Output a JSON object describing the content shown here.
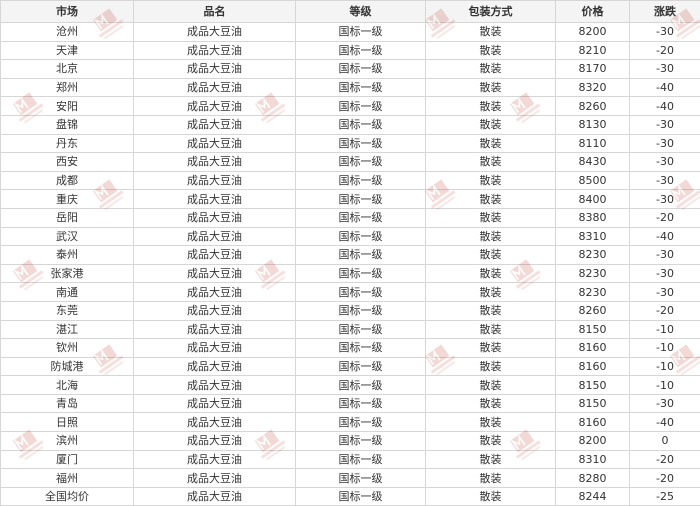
{
  "table": {
    "headers": [
      "市场",
      "品名",
      "等级",
      "包装方式",
      "价格",
      "涨跌"
    ],
    "rows": [
      [
        "沧州",
        "成品大豆油",
        "国标一级",
        "散装",
        "8200",
        "-30"
      ],
      [
        "天津",
        "成品大豆油",
        "国标一级",
        "散装",
        "8210",
        "-20"
      ],
      [
        "北京",
        "成品大豆油",
        "国标一级",
        "散装",
        "8170",
        "-30"
      ],
      [
        "郑州",
        "成品大豆油",
        "国标一级",
        "散装",
        "8320",
        "-40"
      ],
      [
        "安阳",
        "成品大豆油",
        "国标一级",
        "散装",
        "8260",
        "-40"
      ],
      [
        "盘锦",
        "成品大豆油",
        "国标一级",
        "散装",
        "8130",
        "-30"
      ],
      [
        "丹东",
        "成品大豆油",
        "国标一级",
        "散装",
        "8110",
        "-30"
      ],
      [
        "西安",
        "成品大豆油",
        "国标一级",
        "散装",
        "8430",
        "-30"
      ],
      [
        "成都",
        "成品大豆油",
        "国标一级",
        "散装",
        "8500",
        "-30"
      ],
      [
        "重庆",
        "成品大豆油",
        "国标一级",
        "散装",
        "8400",
        "-30"
      ],
      [
        "岳阳",
        "成品大豆油",
        "国标一级",
        "散装",
        "8380",
        "-20"
      ],
      [
        "武汉",
        "成品大豆油",
        "国标一级",
        "散装",
        "8310",
        "-40"
      ],
      [
        "泰州",
        "成品大豆油",
        "国标一级",
        "散装",
        "8230",
        "-30"
      ],
      [
        "张家港",
        "成品大豆油",
        "国标一级",
        "散装",
        "8230",
        "-30"
      ],
      [
        "南通",
        "成品大豆油",
        "国标一级",
        "散装",
        "8230",
        "-30"
      ],
      [
        "东莞",
        "成品大豆油",
        "国标一级",
        "散装",
        "8260",
        "-20"
      ],
      [
        "湛江",
        "成品大豆油",
        "国标一级",
        "散装",
        "8150",
        "-10"
      ],
      [
        "钦州",
        "成品大豆油",
        "国标一级",
        "散装",
        "8160",
        "-10"
      ],
      [
        "防城港",
        "成品大豆油",
        "国标一级",
        "散装",
        "8160",
        "-10"
      ],
      [
        "北海",
        "成品大豆油",
        "国标一级",
        "散装",
        "8150",
        "-10"
      ],
      [
        "青岛",
        "成品大豆油",
        "国标一级",
        "散装",
        "8150",
        "-30"
      ],
      [
        "日照",
        "成品大豆油",
        "国标一级",
        "散装",
        "8160",
        "-40"
      ],
      [
        "滨州",
        "成品大豆油",
        "国标一级",
        "散装",
        "8200",
        "0"
      ],
      [
        "厦门",
        "成品大豆油",
        "国标一级",
        "散装",
        "8310",
        "-20"
      ],
      [
        "福州",
        "成品大豆油",
        "国标一级",
        "散装",
        "8280",
        "-20"
      ],
      [
        "全国均价",
        "成品大豆油",
        "国标一级",
        "散装",
        "8244",
        "-25"
      ]
    ]
  },
  "watermark": {
    "text": "Mysteel.com",
    "color": "#c0392b"
  }
}
